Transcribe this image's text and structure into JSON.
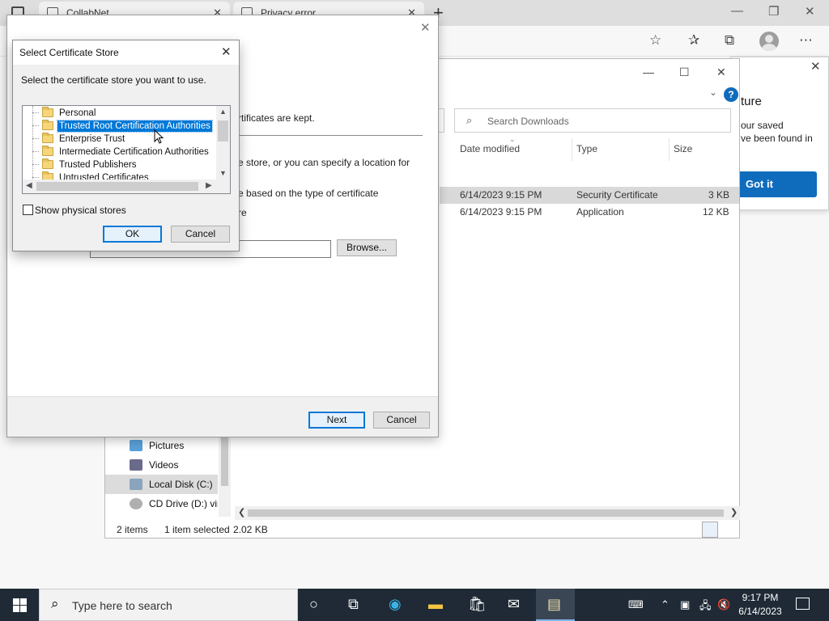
{
  "browser": {
    "tabs": [
      {
        "label": "CollabNet"
      },
      {
        "label": "Privacy error"
      }
    ],
    "new_tab": "+",
    "toolbar_icons": [
      "add-favorite-icon",
      "favorites-icon",
      "collections-icon",
      "profile-icon",
      "more-icon"
    ],
    "popup": {
      "title": "ture",
      "text_line1": "our saved",
      "text_line2": "ve been found in",
      "button": "Got it"
    }
  },
  "explorer": {
    "search_placeholder": "Search Downloads",
    "columns": {
      "date": "Date modified",
      "type": "Type",
      "size": "Size"
    },
    "rows": [
      {
        "date": "6/14/2023 9:15 PM",
        "type": "Security Certificate",
        "size": "3 KB",
        "selected": true
      },
      {
        "date": "6/14/2023 9:15 PM",
        "type": "Application",
        "size": "12 KB",
        "selected": false
      }
    ],
    "nav": [
      {
        "label": "Pictures"
      },
      {
        "label": "Videos"
      },
      {
        "label": "Local Disk (C:)"
      },
      {
        "label": "CD Drive (D:) vir"
      }
    ],
    "status": {
      "items": "2 items",
      "selected": "1 item selected",
      "size": "2.02 KB"
    }
  },
  "wizard": {
    "line1": "rtificates are kept.",
    "line2": "e store, or you can specify a location for",
    "line3": "e based on the type of certificate",
    "line4": "re",
    "browse": "Browse...",
    "next": "Next",
    "cancel": "Cancel"
  },
  "certstore": {
    "title": "Select Certificate Store",
    "prompt": "Select the certificate store you want to use.",
    "stores": [
      {
        "label": "Personal"
      },
      {
        "label": "Trusted Root Certification Authorities"
      },
      {
        "label": "Enterprise Trust"
      },
      {
        "label": "Intermediate Certification Authorities"
      },
      {
        "label": "Trusted Publishers"
      },
      {
        "label": "Untrusted Certificates"
      }
    ],
    "selected_store": "Trusted Root Certification Authorities",
    "show_physical": "Show physical stores",
    "show_physical_checked": false,
    "ok": "OK",
    "cancel": "Cancel"
  },
  "taskbar": {
    "search_placeholder": "Type here to search",
    "time": "9:17 PM",
    "date": "6/14/2023"
  },
  "colors": {
    "accent": "#0078d7",
    "taskbar": "#1f2a36",
    "edge_button": "#0f6cbd"
  }
}
